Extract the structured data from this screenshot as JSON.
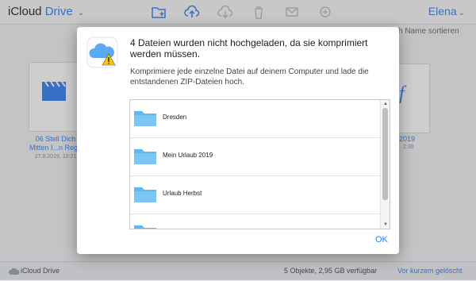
{
  "app": {
    "title_left": "iCloud",
    "title_right": "Drive",
    "user": "Elena"
  },
  "toolbar": {
    "icons": [
      "new-folder-icon",
      "upload-icon",
      "download-icon",
      "trash-icon",
      "mail-icon",
      "share-icon"
    ]
  },
  "sort": {
    "label": "h Name sortieren"
  },
  "files": {
    "left": {
      "name_line1": "06 Stell Dich",
      "name_line2": "Mitten I...n Rege",
      "meta": "27.8.2019, 10:21"
    },
    "right": {
      "name": "_2019",
      "meta": "2:30"
    }
  },
  "dialog": {
    "title": "4 Dateien wurden nicht hochgeladen, da sie komprimiert werden müssen.",
    "subtitle": "Komprimiere jede einzelne Datei auf deinem Computer und lade die entstandenen ZIP-Dateien hoch.",
    "items": [
      {
        "label": "Dresden"
      },
      {
        "label": "Mein Urlaub 2019"
      },
      {
        "label": "Urlaub Herbst"
      }
    ],
    "ok": "OK"
  },
  "status": {
    "left": "iCloud Drive",
    "mid": "5 Objekte, 2,95 GB verfügbar",
    "right": "Vor kurzem gelöscht"
  },
  "colors": {
    "accent": "#2f7cf6",
    "folder": "#5fb8ec",
    "warning": "#f5c518"
  }
}
